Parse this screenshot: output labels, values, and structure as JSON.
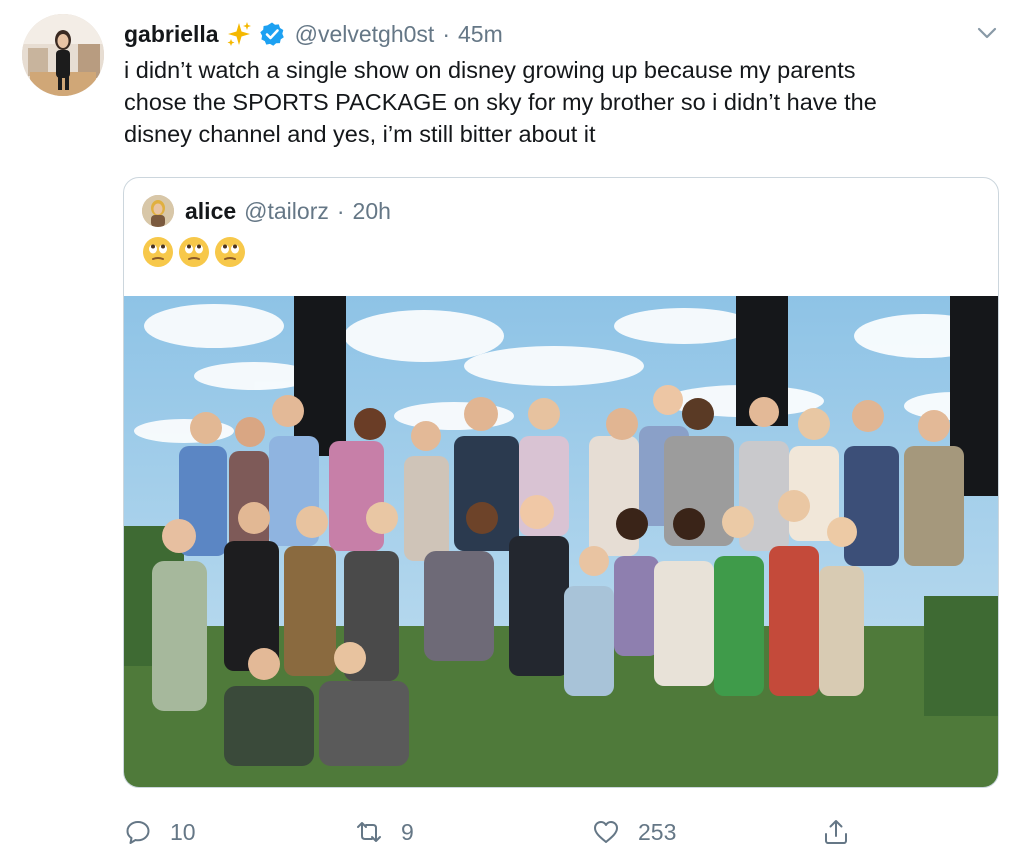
{
  "tweet": {
    "author_name": "gabriella",
    "author_handle": "@velvetgh0st",
    "separator": "·",
    "time": "45m",
    "text": "i didn’t watch a single show on disney growing up because my parents\nchose the SPORTS PACKAGE on sky for my brother so i didn’t have the\ndisney channel and yes, i’m still bitter about it"
  },
  "quoted_tweet": {
    "author_name": "alice",
    "author_handle": "@tailorz",
    "separator": "·",
    "time": "20h",
    "emojis": [
      "face-with-rolling-eyes",
      "face-with-rolling-eyes",
      "face-with-rolling-eyes"
    ]
  },
  "actions": {
    "reply_count": "10",
    "retweet_count": "9",
    "like_count": "253"
  },
  "colors": {
    "text_primary": "#14171a",
    "text_secondary": "#657786",
    "verified_blue": "#1da1f2",
    "border": "#ccd6dd"
  }
}
